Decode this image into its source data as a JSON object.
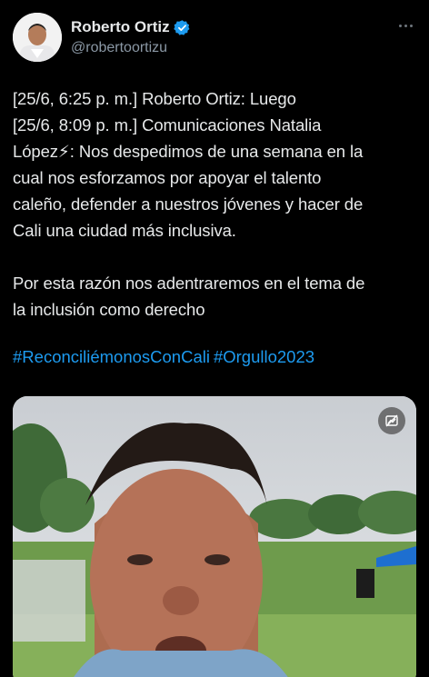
{
  "author": {
    "name": "Roberto Ortiz",
    "handle": "@robertoortizu",
    "verified_color": "#1d9bf0"
  },
  "tweet": {
    "lines": [
      "[25/6, 6:25 p. m.] Roberto Ortiz: Luego",
      "[25/6, 8:09 p. m.] Comunicaciones Natalia",
      "López⚡: Nos despedimos de una semana en la",
      "cual nos esforzamos por apoyar el talento",
      "caleño, defender a nuestros jóvenes y hacer de",
      "Cali una ciudad más inclusiva."
    ],
    "paragraph2": [
      "Por esta razón nos adentraremos en el tema de",
      "la inclusión como derecho"
    ],
    "hashtags": [
      "#ReconciliémonosConCali",
      "#Orgullo2023"
    ]
  },
  "icons": {
    "more": "more-icon",
    "verified": "verified-badge-icon",
    "media_badge": "content-warning-icon"
  },
  "colors": {
    "background": "#000000",
    "text": "#e7e9ea",
    "secondary": "#8b98a5",
    "link": "#1d9bf0"
  }
}
